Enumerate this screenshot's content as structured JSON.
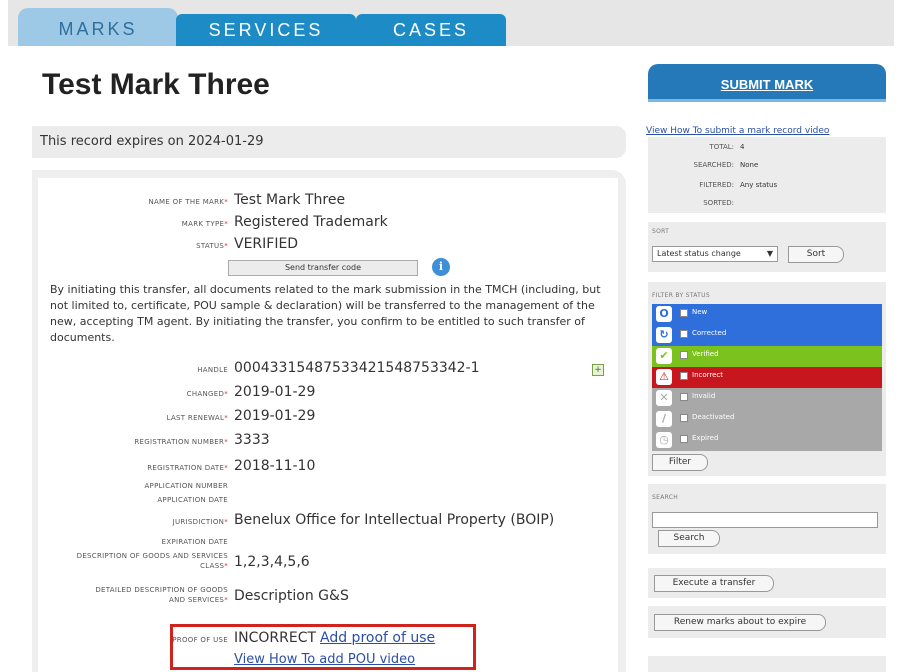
{
  "tabs": [
    {
      "label": "MARKS"
    },
    {
      "label": "SERVICES"
    },
    {
      "label": "CASES"
    }
  ],
  "page": {
    "title": "Test Mark Three",
    "expiry": "This record expires on 2024-01-29"
  },
  "record": {
    "name": {
      "label": "NAME OF THE MARK",
      "value": "Test Mark Three"
    },
    "type": {
      "label": "MARK TYPE",
      "value": "Registered Trademark"
    },
    "status": {
      "label": "STATUS",
      "value": "VERIFIED"
    },
    "transfer_button": "Send transfer code",
    "transfer_text": "By initiating this transfer, all documents related to the mark submission in the TMCH (including, but not limited to, certificate, POU sample & declaration) will be transferred to the management of the new, accepting TM agent. By initiating the transfer, you confirm to be entitled to such transfer of documents.",
    "handle": {
      "label": "HANDLE",
      "value": "00043315487533421548753342-1"
    },
    "changed": {
      "label": "CHANGED",
      "value": "2019-01-29"
    },
    "last_renewal": {
      "label": "LAST RENEWAL",
      "value": "2019-01-29"
    },
    "reg_number": {
      "label": "REGISTRATION NUMBER",
      "value": "3333"
    },
    "reg_date": {
      "label": "REGISTRATION DATE",
      "value": "2018-11-10"
    },
    "app_number": {
      "label": "APPLICATION NUMBER"
    },
    "app_date": {
      "label": "APPLICATION DATE"
    },
    "jurisdiction": {
      "label": "JURISDICTION",
      "value": "Benelux Office for Intellectual Property (BOIP)"
    },
    "expiration": {
      "label": "EXPIRATION DATE"
    },
    "class": {
      "label_line1": "DESCRIPTION OF GOODS AND SERVICES",
      "label_line2": "CLASS",
      "value": "1,2,3,4,5,6"
    },
    "detailed": {
      "label_line1": "DETAILED DESCRIPTION OF GOODS",
      "label_line2": "AND SERVICES",
      "value": "Description G&S"
    },
    "pou": {
      "label": "PROOF OF USE",
      "value": "INCORRECT",
      "add_link": "Add proof of use",
      "video_link": "View How To add POU video"
    }
  },
  "sidebar": {
    "submit_button": "SUBMIT MARK",
    "video_link": "View How To submit a mark record video",
    "stats": [
      {
        "key": "TOTAL:",
        "value": "4"
      },
      {
        "key": "SEARCHED:",
        "value": "None"
      },
      {
        "key": "FILTERED:",
        "value": "Any status"
      },
      {
        "key": "SORTED:",
        "value": ""
      }
    ],
    "sort": {
      "title": "SORT",
      "selected": "Latest status change",
      "button": "Sort"
    },
    "filter": {
      "title": "FILTER BY STATUS",
      "statuses": [
        {
          "label": "New",
          "color": "#2e6fdc",
          "icon": "O"
        },
        {
          "label": "Corrected",
          "color": "#2e6fdc",
          "icon": "↻"
        },
        {
          "label": "Verified",
          "color": "#7cc21e",
          "icon": "✔"
        },
        {
          "label": "Incorrect",
          "color": "#c8161e",
          "icon": "⚠"
        },
        {
          "label": "Invalid",
          "color": "#a8a8a8",
          "icon": "✕"
        },
        {
          "label": "Deactivated",
          "color": "#a8a8a8",
          "icon": "/"
        },
        {
          "label": "Expired",
          "color": "#a8a8a8",
          "icon": "◷"
        }
      ],
      "button": "Filter"
    },
    "search": {
      "title": "SEARCH",
      "button": "Search"
    },
    "execute_button": "Execute a transfer",
    "renew_button": "Renew marks about to expire"
  }
}
